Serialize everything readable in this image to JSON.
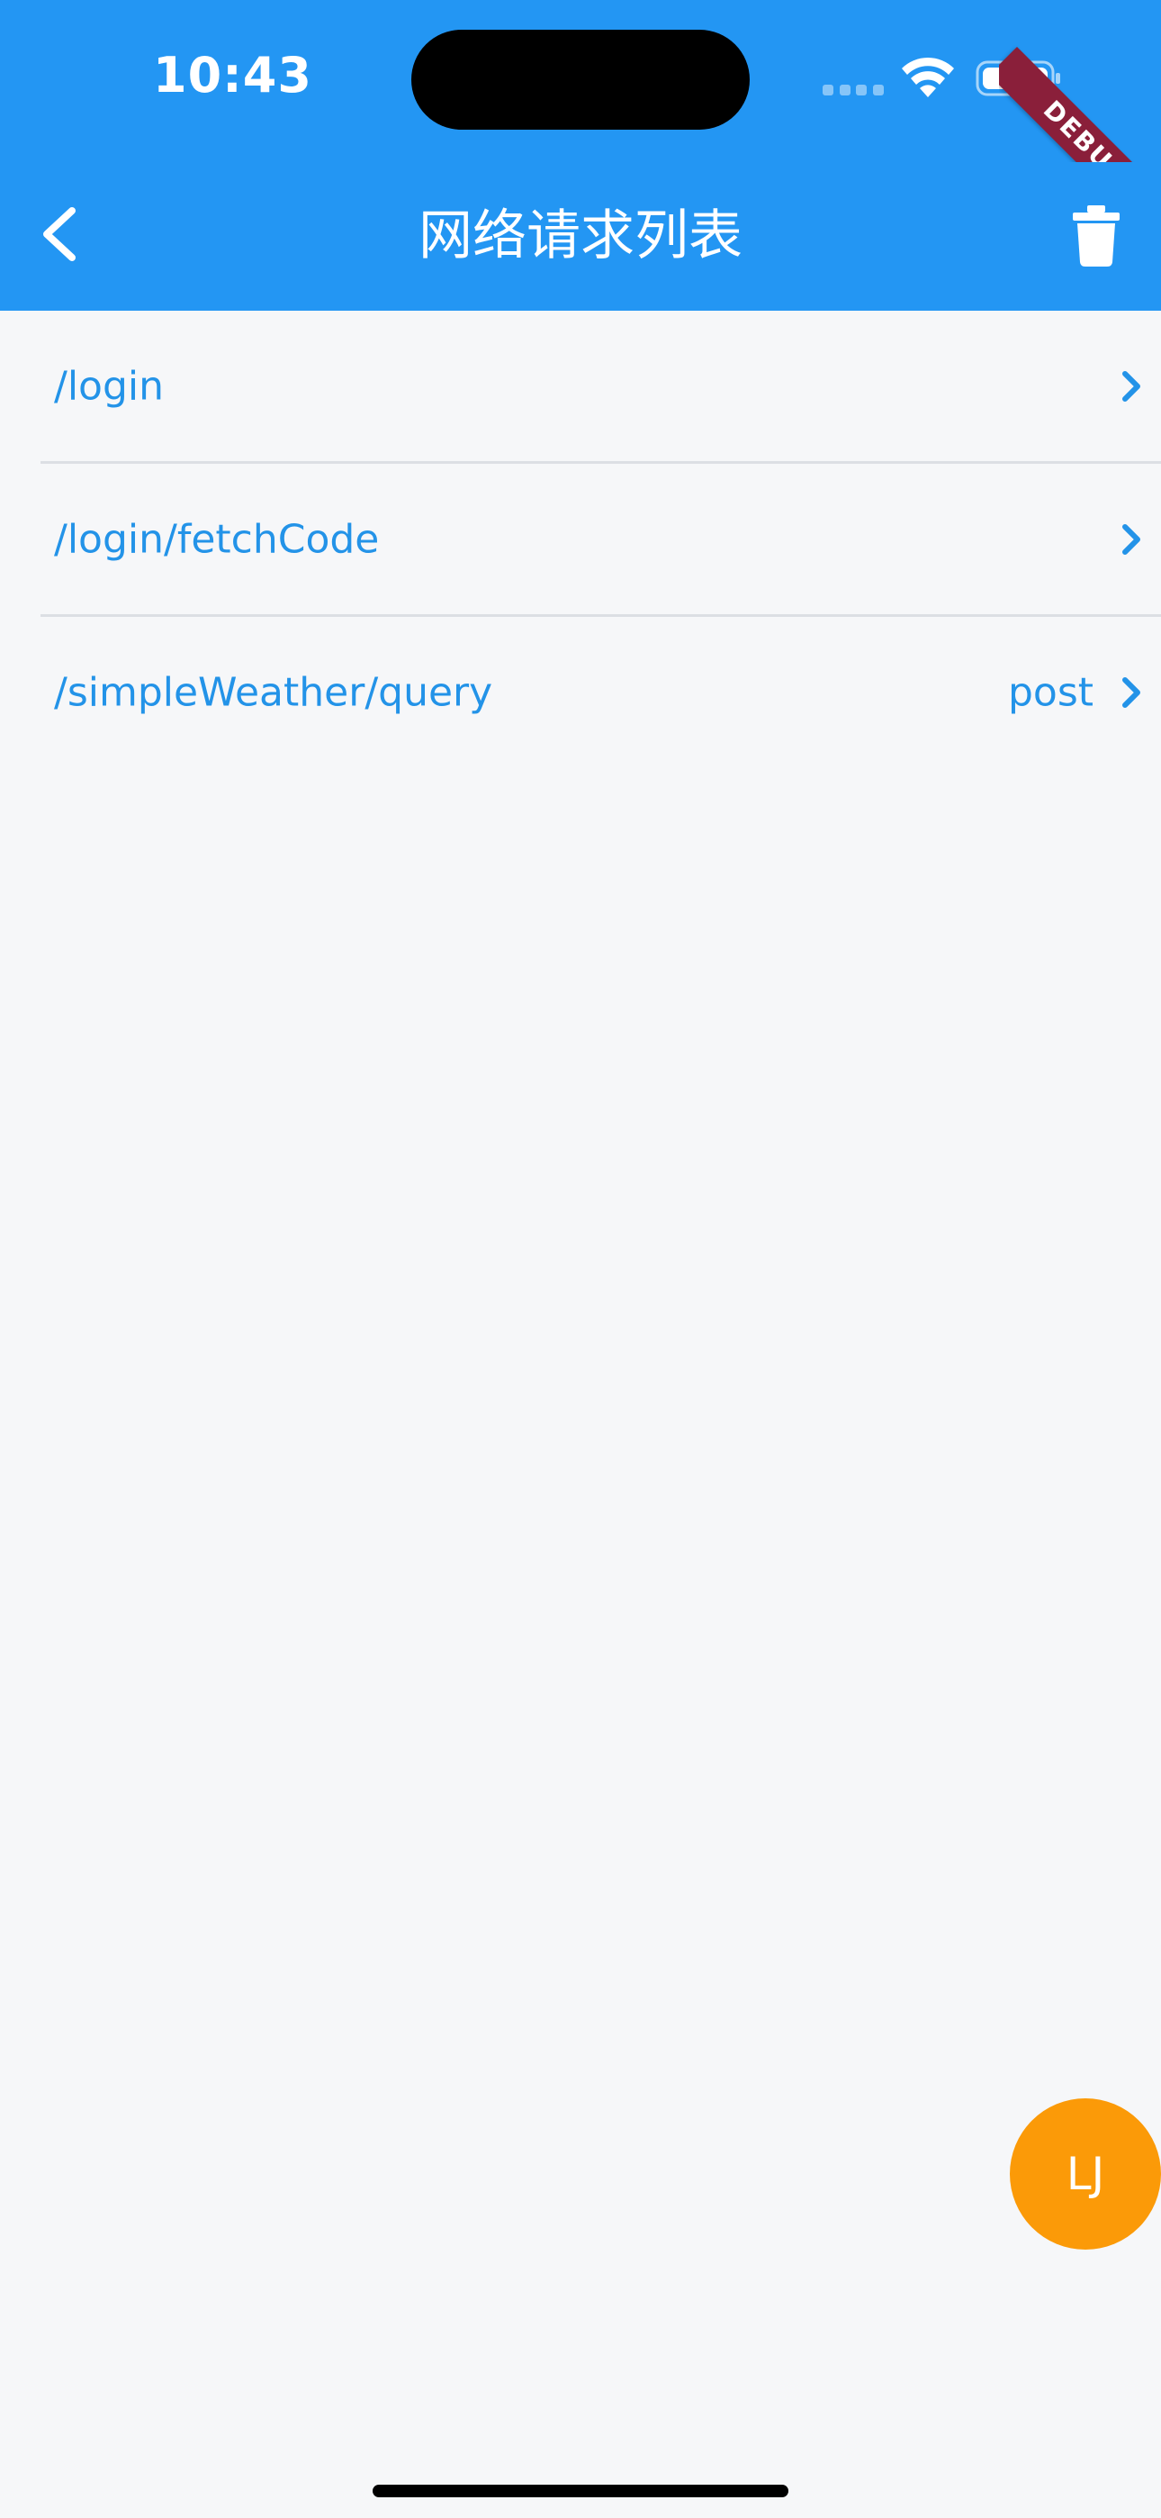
{
  "status_bar": {
    "time": "10:43"
  },
  "debug_banner": {
    "label": "DEBUG"
  },
  "app_bar": {
    "title": "网络请求列表",
    "back_icon": "chevron-left-icon",
    "action_icon": "trash-icon"
  },
  "requests": [
    {
      "path": "/login",
      "method": ""
    },
    {
      "path": "/login/fetchCode",
      "method": ""
    },
    {
      "path": "/simpleWeather/query",
      "method": "post"
    }
  ],
  "fab": {
    "label": "LJ"
  },
  "colors": {
    "app_bar": "#2396f3",
    "link": "#2393e8",
    "background": "#f6f7f9",
    "fab": "#fb9a08",
    "debug_ribbon": "#8a1f3a"
  }
}
